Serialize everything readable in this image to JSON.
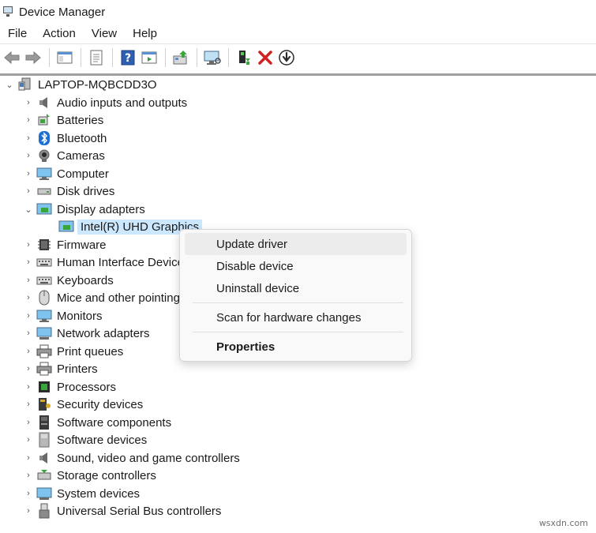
{
  "window": {
    "title": "Device Manager",
    "icon": "device-manager-icon"
  },
  "menubar": {
    "items": [
      "File",
      "Action",
      "View",
      "Help"
    ]
  },
  "toolbar": {
    "buttons": [
      "back-icon",
      "forward-icon",
      "show-hide-console-tree-icon",
      "properties-sheet-icon",
      "help-icon",
      "action-pane-icon",
      "update-driver-icon",
      "scan-hardware-icon",
      "enable-device-icon",
      "uninstall-device-icon",
      "download-icon"
    ]
  },
  "tree": {
    "root": "LAPTOP-MQBCDD3O",
    "categories": [
      {
        "label": "Audio inputs and outputs",
        "icon": "speaker-icon",
        "expanded": false
      },
      {
        "label": "Batteries",
        "icon": "battery-icon",
        "expanded": false
      },
      {
        "label": "Bluetooth",
        "icon": "bluetooth-icon",
        "expanded": false
      },
      {
        "label": "Cameras",
        "icon": "camera-icon",
        "expanded": false
      },
      {
        "label": "Computer",
        "icon": "computer-icon",
        "expanded": false
      },
      {
        "label": "Disk drives",
        "icon": "disk-drive-icon",
        "expanded": false
      },
      {
        "label": "Display adapters",
        "icon": "display-adapter-icon",
        "expanded": true,
        "children": [
          "Intel(R) UHD Graphics"
        ]
      },
      {
        "label": "Firmware",
        "icon": "firmware-icon",
        "expanded": false
      },
      {
        "label": "Human Interface Devices",
        "icon": "hid-icon",
        "expanded": false
      },
      {
        "label": "Keyboards",
        "icon": "keyboard-icon",
        "expanded": false
      },
      {
        "label": "Mice and other pointing devices",
        "icon": "mouse-icon",
        "expanded": false
      },
      {
        "label": "Monitors",
        "icon": "monitor-icon",
        "expanded": false
      },
      {
        "label": "Network adapters",
        "icon": "network-adapter-icon",
        "expanded": false
      },
      {
        "label": "Print queues",
        "icon": "print-queue-icon",
        "expanded": false
      },
      {
        "label": "Printers",
        "icon": "printer-icon",
        "expanded": false
      },
      {
        "label": "Processors",
        "icon": "processor-icon",
        "expanded": false
      },
      {
        "label": "Security devices",
        "icon": "security-device-icon",
        "expanded": false
      },
      {
        "label": "Software components",
        "icon": "software-component-icon",
        "expanded": false
      },
      {
        "label": "Software devices",
        "icon": "software-device-icon",
        "expanded": false
      },
      {
        "label": "Sound, video and game controllers",
        "icon": "sound-controller-icon",
        "expanded": false
      },
      {
        "label": "Storage controllers",
        "icon": "storage-controller-icon",
        "expanded": false
      },
      {
        "label": "System devices",
        "icon": "system-device-icon",
        "expanded": false
      },
      {
        "label": "Universal Serial Bus controllers",
        "icon": "usb-controller-icon",
        "expanded": false
      }
    ]
  },
  "context_menu": {
    "items": [
      "Update driver",
      "Disable device",
      "Uninstall device"
    ],
    "scan": "Scan for hardware changes",
    "properties": "Properties"
  },
  "watermark": "wsxdn.com",
  "colors": {
    "selection": "#cce8ff",
    "menu_hover": "#ececec",
    "menu_bg": "#f9f9f9"
  }
}
